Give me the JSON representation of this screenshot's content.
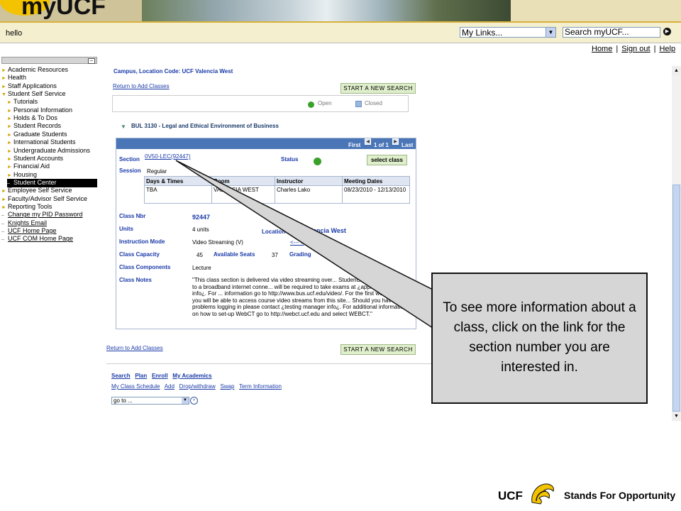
{
  "banner": {
    "logo": "myUCF"
  },
  "header": {
    "greeting": "hello",
    "mylinks_value": "My Links...",
    "search_value": "Search myUCF...",
    "toplinks": [
      "Home",
      "Sign out",
      "Help"
    ]
  },
  "nav": {
    "items": [
      {
        "label": "Academic Resources",
        "bullet": "►",
        "indent": 0,
        "link": false
      },
      {
        "label": "Health",
        "bullet": "►",
        "indent": 0,
        "link": false
      },
      {
        "label": "Staff Applications",
        "bullet": "►",
        "indent": 0,
        "link": false
      },
      {
        "label": "Student Self Service",
        "bullet": "▼",
        "indent": 0,
        "link": false
      },
      {
        "label": "Tutorials",
        "bullet": "►",
        "indent": 1,
        "link": false
      },
      {
        "label": "Personal Information",
        "bullet": "►",
        "indent": 1,
        "link": false
      },
      {
        "label": "Holds & To Dos",
        "bullet": "►",
        "indent": 1,
        "link": false
      },
      {
        "label": "Student Records",
        "bullet": "►",
        "indent": 1,
        "link": false
      },
      {
        "label": "Graduate Students",
        "bullet": "►",
        "indent": 1,
        "link": false
      },
      {
        "label": "International Students",
        "bullet": "►",
        "indent": 1,
        "link": false
      },
      {
        "label": "Undergraduate Admissions",
        "bullet": "►",
        "indent": 1,
        "link": false
      },
      {
        "label": "Student Accounts",
        "bullet": "►",
        "indent": 1,
        "link": false
      },
      {
        "label": "Financial Aid",
        "bullet": "►",
        "indent": 1,
        "link": false
      },
      {
        "label": "Housing",
        "bullet": "►",
        "indent": 1,
        "link": false
      },
      {
        "label": "Student Center",
        "bullet": "–",
        "indent": 1,
        "link": false,
        "selected": true
      },
      {
        "label": "Employee Self Service",
        "bullet": "►",
        "indent": 0,
        "link": false
      },
      {
        "label": "Faculty/Advisor Self Service",
        "bullet": "►",
        "indent": 0,
        "link": false
      },
      {
        "label": "Reporting Tools",
        "bullet": "►",
        "indent": 0,
        "link": false
      },
      {
        "label": "Change my PID Password",
        "bullet": "–",
        "indent": 0,
        "link": true
      },
      {
        "label": "Knights Email",
        "bullet": "–",
        "indent": 0,
        "link": true
      },
      {
        "label": "UCF Home Page",
        "bullet": "–",
        "indent": 0,
        "link": true
      },
      {
        "label": "UCF COM Home Page",
        "bullet": "–",
        "indent": 0,
        "link": true
      }
    ]
  },
  "content": {
    "campus_line": "Campus, Location Code: UCF Valencia West",
    "return_link": "Return to Add Classes",
    "new_search": "START A NEW SEARCH",
    "legend_open": "Open",
    "legend_closed": "Closed",
    "course_title": "BUL 3130 - Legal and Ethical Environment of Business",
    "pager_first": "First",
    "pager_count": "1 of 1",
    "pager_last": "Last",
    "section_label": "Section",
    "section_link": "0V50-LEC(92447)",
    "status_label": "Status",
    "select_class": "select class",
    "session_label": "Session",
    "session_value": "Regular",
    "meeting_headers": [
      "Days & Times",
      "Room",
      "Instructor",
      "Meeting Dates"
    ],
    "meeting_row": [
      "TBA",
      "VALENCIA WEST",
      "Charles Lako",
      "08/23/2010 - 12/13/2010"
    ],
    "class_nbr_label": "Class Nbr",
    "class_nbr_value": "92447",
    "units_label": "Units",
    "units_value": "4 units",
    "location_label": "Location",
    "location_value": "Valencia West",
    "instruction_mode_label": "Instruction Mode",
    "instruction_mode_value": "Video Streaming (V)",
    "class_capacity_label": "Class Capacity",
    "class_capacity_value": "45",
    "available_seats_label": "Available Seats",
    "available_seats_value": "37",
    "grading_label": "Grading",
    "components_label": "Class Components",
    "components_value": "Lecture",
    "notes_label": "Class Notes",
    "notes_value": "\"This class section is delivered via video streaming over... Students must have access to a broadband internet conne... will be required to take exams at ¿appropriate site info¿. For ... information go to http://www.bus.ucf.edu/video/. For the first we... class, you will be able to access course video streams from this site... Should you have problems logging in please contact ¿testing manager info¿. For additional information on how to set-up WebCT go to http://webct.ucf.edu and select WEBCT.\"",
    "bottom_links_1": [
      "Search",
      "Plan",
      "Enroll",
      "My Academics"
    ],
    "bottom_links_2": [
      "My Class Schedule",
      "Add",
      "Drop/withdraw",
      "Swap",
      "Term Information"
    ],
    "goto_value": "go to ..."
  },
  "callout": {
    "text": "To see more information about a class, click on the link for the section number you are interested in."
  },
  "footer": {
    "ucf": "UCF",
    "tagline": "Stands For Opportunity"
  },
  "colors": {
    "ucf_gold": "#f3c300",
    "link_blue": "#1a3aa8",
    "header_blue": "#4a76b8",
    "open_green": "#3aa12b"
  }
}
